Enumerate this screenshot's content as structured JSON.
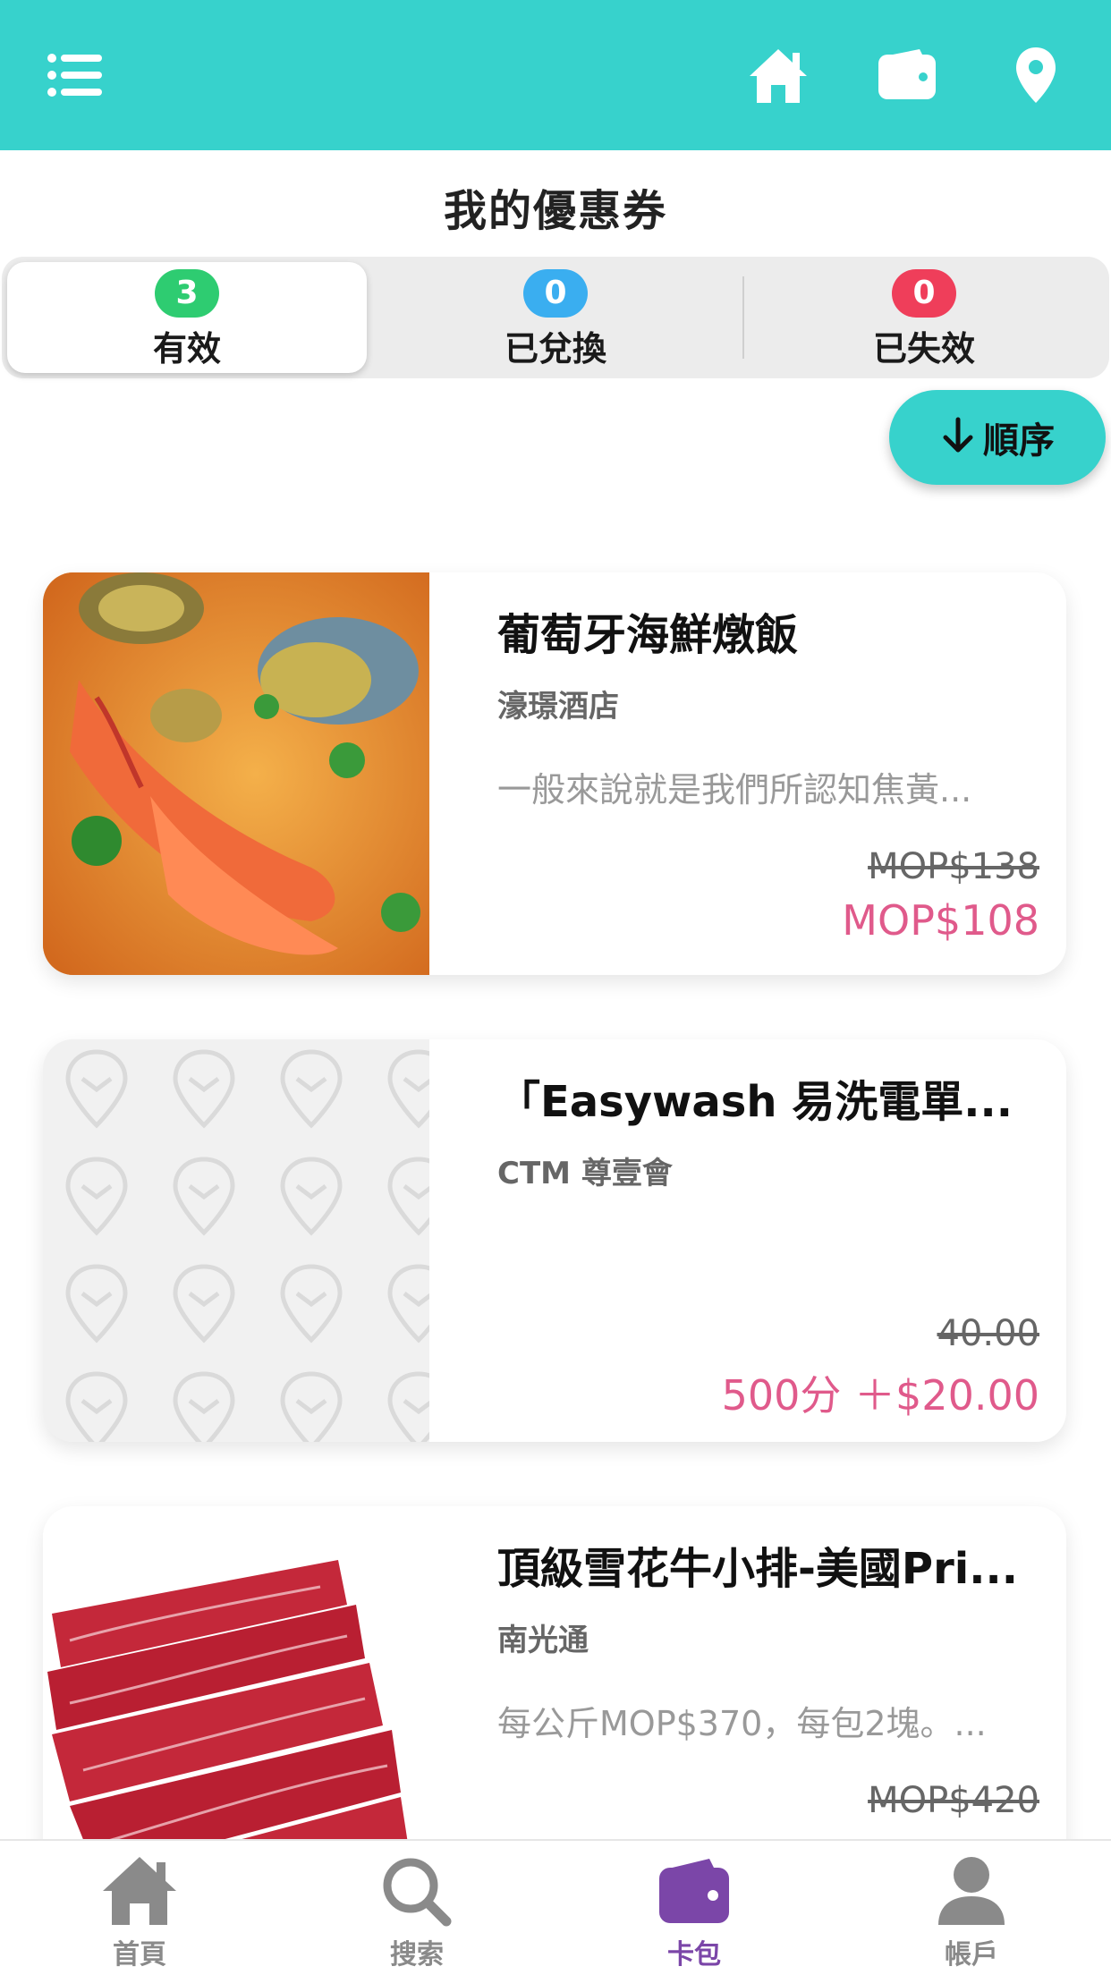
{
  "header": {
    "menu_icon": "menu-icon",
    "home_icon": "home-icon",
    "wallet_icon": "wallet-icon",
    "location_icon": "location-pin-icon",
    "background_color": "#37d2cc"
  },
  "page_title": "我的優惠券",
  "tabs": [
    {
      "label": "有效",
      "count": "3",
      "badge_color": "#2ecc71",
      "active": true
    },
    {
      "label": "已兌換",
      "count": "0",
      "badge_color": "#3aaef0",
      "active": false
    },
    {
      "label": "已失效",
      "count": "0",
      "badge_color": "#ef3e5a",
      "active": false
    }
  ],
  "sort": {
    "label": "順序",
    "icon": "arrow-down-icon"
  },
  "coupons": [
    {
      "title": "葡萄牙海鮮燉飯",
      "merchant": "濠璟酒店",
      "description": "一般來說就是我們所認知焦黃...",
      "original_price": "MOP$138",
      "price": "MOP$108",
      "image": "seafood-rice-photo"
    },
    {
      "title": "「Easywash 易洗電單...",
      "merchant": "CTM 尊壹會",
      "description": "",
      "original_price": "40.00",
      "price": "500分 ＋$20.00",
      "image": "placeholder-logo-pattern"
    },
    {
      "title": "頂級雪花牛小排-美國Pri...",
      "merchant": "南光通",
      "description": "每公斤MOP$370，每包2塊。...",
      "original_price": "MOP$420",
      "price": "",
      "image": "beef-short-rib-photo"
    }
  ],
  "bottom_nav": [
    {
      "label": "首頁",
      "icon": "home-icon",
      "active": false
    },
    {
      "label": "搜索",
      "icon": "search-icon",
      "active": false
    },
    {
      "label": "卡包",
      "icon": "wallet-icon",
      "active": true
    },
    {
      "label": "帳戶",
      "icon": "user-icon",
      "active": false
    }
  ],
  "colors": {
    "accent": "#37d2cc",
    "price": "#e05a8b",
    "active_nav": "#7b46a8"
  }
}
